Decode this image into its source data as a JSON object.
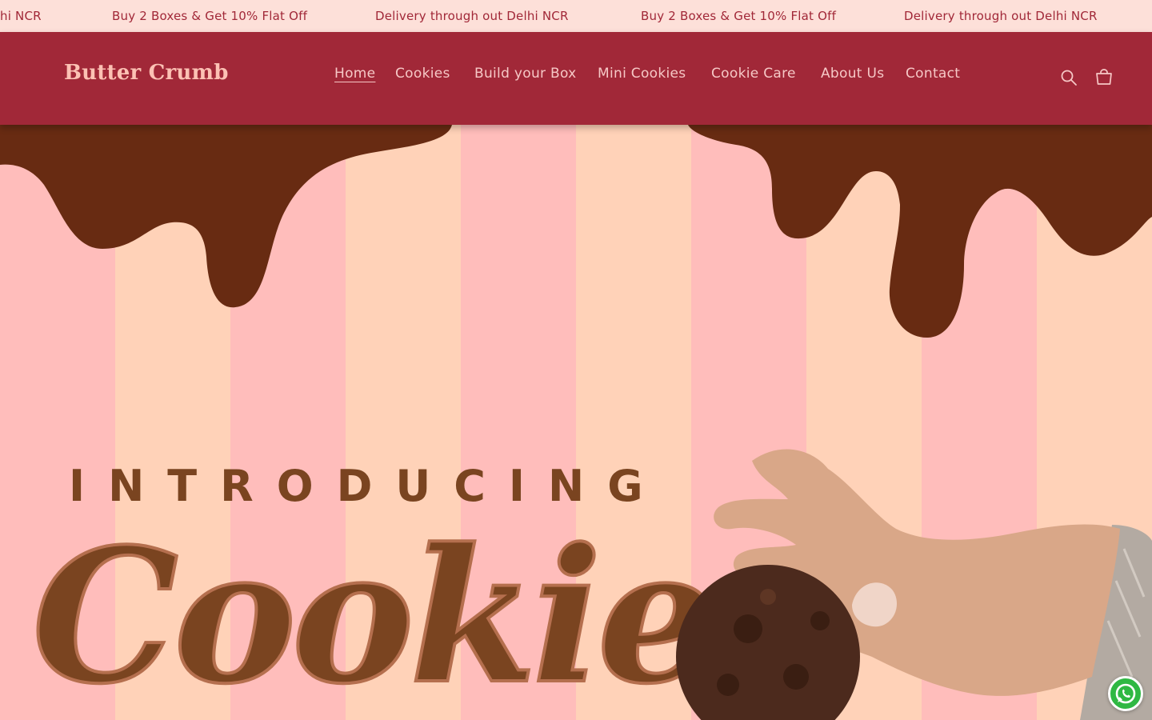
{
  "announcement": {
    "messages": [
      "hi NCR",
      "Buy 2 Boxes & Get 10% Flat Off",
      "Delivery through out Delhi NCR",
      "Buy 2 Boxes & Get 10% Flat Off",
      "Delivery through out Delhi NCR"
    ]
  },
  "header": {
    "logo": "Butter Crumb",
    "nav": [
      {
        "label": "Home",
        "active": true
      },
      {
        "label": "Cookies"
      },
      {
        "label": "Build your Box"
      },
      {
        "label": "Mini Cookies"
      },
      {
        "label": "Cookie Care"
      },
      {
        "label": "About Us"
      },
      {
        "label": "Contact"
      }
    ],
    "icons": [
      "search-icon",
      "cart-icon"
    ]
  },
  "hero": {
    "kicker": "INTRODUCING",
    "headline": "Cookies"
  },
  "floating": {
    "icon": "whatsapp-icon"
  },
  "colors": {
    "announcement_bg": "#fde0d9",
    "brand": "#a12838",
    "logo": "#fcc1b4",
    "chocolate": "#682b12",
    "stripe_pink": "#ffbdbb",
    "stripe_peach": "#ffd2b8",
    "headline": "#7a4420",
    "whatsapp": "#2fb843"
  }
}
